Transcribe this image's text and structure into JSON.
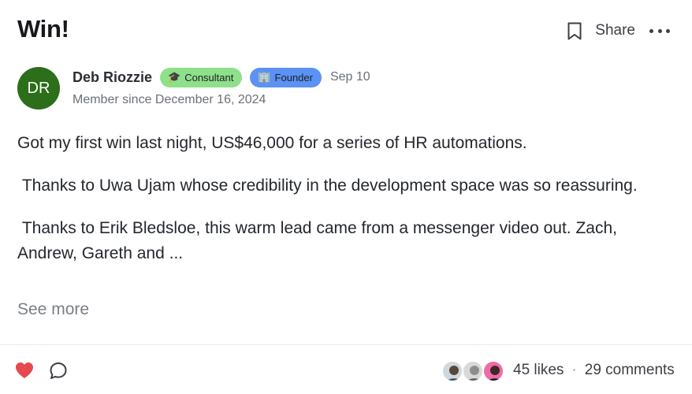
{
  "post": {
    "title": "Win!",
    "share_label": "Share",
    "author": {
      "initials": "DR",
      "name": "Deb Riozzie",
      "badges": [
        {
          "icon": "🎓",
          "label": "Consultant",
          "color": "#8ee08a"
        },
        {
          "icon": "🏢",
          "label": "Founder",
          "color": "#5b92f3"
        }
      ],
      "date": "Sep 10",
      "member_since": "Member since December 16, 2024",
      "avatar_color": "#2c6e19"
    },
    "paragraphs": [
      "Got my first win last night, US$46,000 for a series of HR automations.",
      " Thanks to Uwa Ujam whose credibility in the development space was so reassuring.",
      " Thanks to Erik Bledsloe, this warm lead came from a messenger video out. Zach, Andrew, Gareth and ..."
    ],
    "see_more": "See more",
    "likes": "45 likes",
    "separator": "·",
    "comments": "29 comments",
    "like_color": "#e5484d"
  }
}
